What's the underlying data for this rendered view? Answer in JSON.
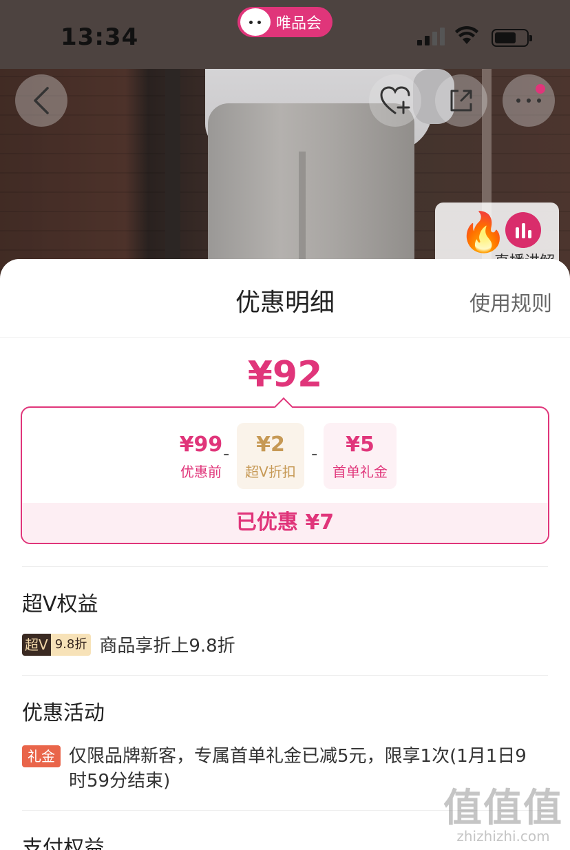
{
  "status_bar": {
    "time": "13:34",
    "app_badge": "唯品会"
  },
  "photo": {
    "live_label": "直播讲解"
  },
  "icons": {
    "back": "chevron-left-icon",
    "favorite": "heart-plus-icon",
    "share": "share-icon",
    "more": "more-dots-icon"
  },
  "sheet": {
    "title": "优惠明细",
    "rules_link": "使用规则",
    "final_price": "¥92",
    "breakdown": {
      "before": {
        "amount": "¥99",
        "label": "优惠前"
      },
      "minus": "-",
      "vip": {
        "amount": "¥2",
        "label": "超V折扣"
      },
      "gift": {
        "amount": "¥5",
        "label": "首单礼金"
      },
      "saved": "已优惠 ¥7"
    },
    "vip_section": {
      "title": "超V权益",
      "badge_left": "超V",
      "badge_right": "9.8折",
      "text": "商品享折上9.8折"
    },
    "promo_section": {
      "title": "优惠活动",
      "badge": "礼金",
      "text": "仅限品牌新客，专属首单礼金已减5元，限享1次(1月1日9时59分结束)"
    },
    "pay_section": {
      "title": "支付权益"
    }
  },
  "watermark": {
    "big": "值值值",
    "small": "zhizhizhi.com"
  },
  "colors": {
    "accent": "#e0357a",
    "vip_gold": "#c69955",
    "gift_orange": "#e9654a"
  }
}
